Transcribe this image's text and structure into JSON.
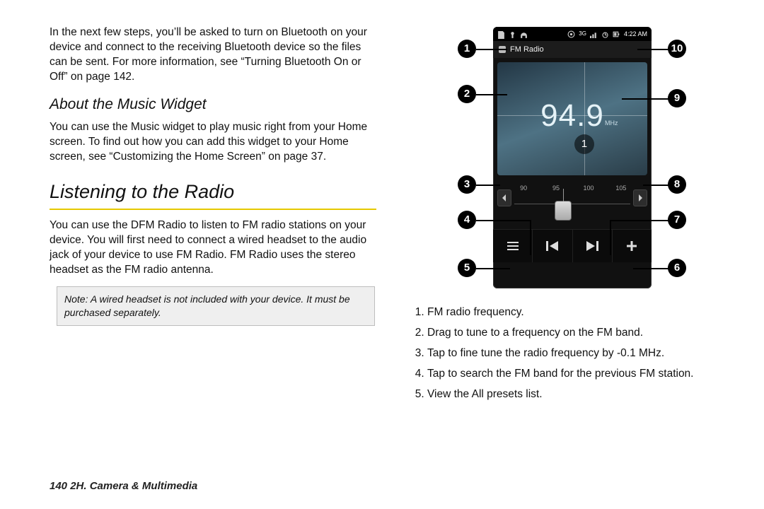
{
  "para_bluetooth": "In the next few steps, you’ll be asked to turn on Bluetooth on your device and connect to the receiving Bluetooth device so the files can be sent. For more information, see “Turning Bluetooth On or Off” on page 142.",
  "heading_widget": "About the Music Widget",
  "para_widget": "You can use the Music widget to play music right from your Home screen. To find out how you can add this widget to your Home screen, see “Customizing the Home Screen” on page 37.",
  "heading_radio": "Listening to the Radio",
  "para_radio": "You can use the DFM Radio to listen to FM radio stations on your device. You will first need to connect a wired headset to the audio jack of your device to use FM Radio. FM Radio uses the stereo headset as the FM radio antenna.",
  "note_label": "Note:",
  "note_text": " A wired headset is not included with your device. It must be purchased separately.",
  "footer": "140    2H. Camera & Multimedia",
  "phone": {
    "status_time": "4:22 AM",
    "status_net": "3G",
    "app_title": "FM Radio",
    "frequency": "94.9",
    "unit": "MHz",
    "preset_label": "1",
    "scale_ticks": [
      "90",
      "95",
      "100",
      "105"
    ]
  },
  "callouts": {
    "c1": "1",
    "c2": "2",
    "c3": "3",
    "c4": "4",
    "c5": "5",
    "c6": "6",
    "c7": "7",
    "c8": "8",
    "c9": "9",
    "c10": "10"
  },
  "legend": {
    "i1": "FM radio frequency.",
    "i2": "Drag to tune to a frequency on the FM band.",
    "i3": "Tap to fine tune the radio frequency by -0.1 MHz.",
    "i4": "Tap to search the FM band for the previous FM station.",
    "i5": "View the All presets list."
  }
}
